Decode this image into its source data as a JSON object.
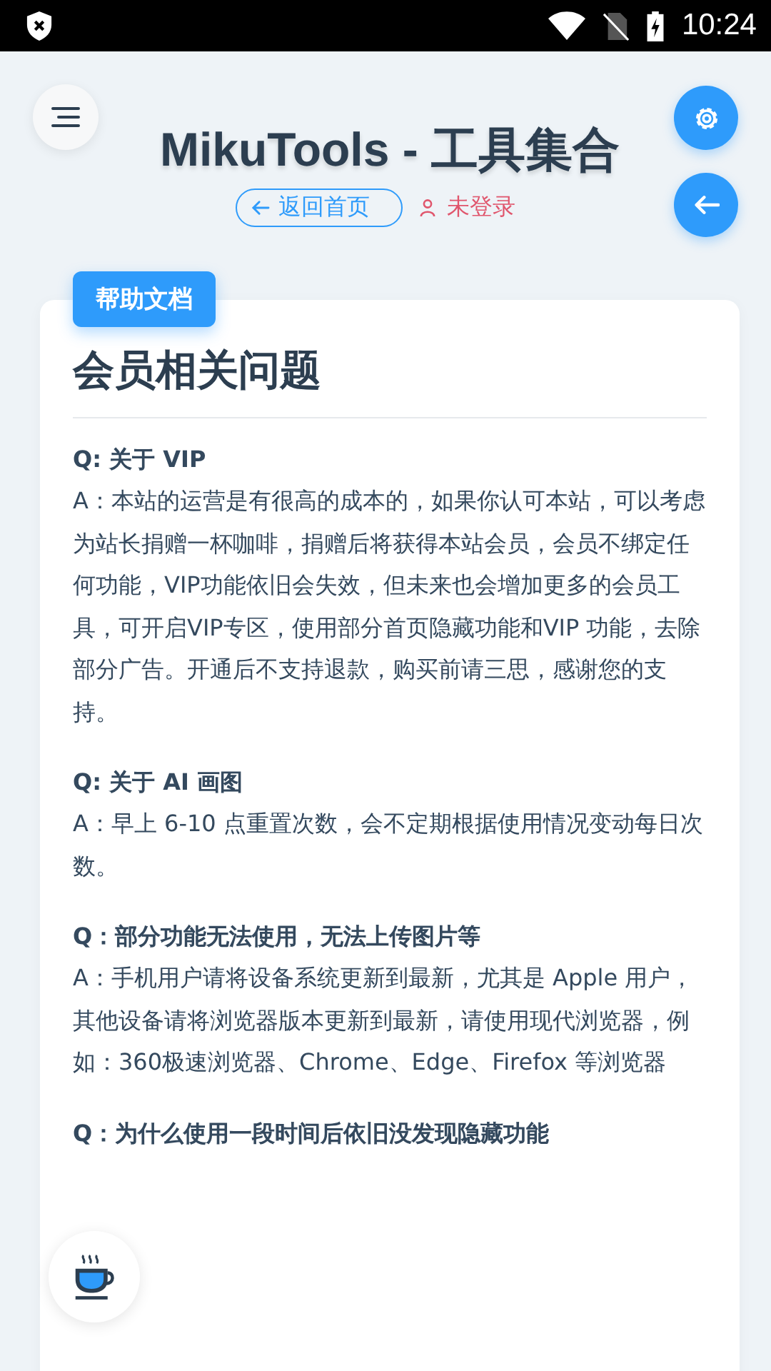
{
  "status_bar": {
    "time": "10:24"
  },
  "header": {
    "title": "MikuTools - 工具集合",
    "back_link": "返回首页",
    "login_status": "未登录"
  },
  "card": {
    "badge": "帮助文档",
    "heading": "会员相关问题",
    "faqs": [
      {
        "question": "Q: 关于 VIP",
        "answer": "A：本站的运营是有很高的成本的，如果你认可本站，可以考虑为站长捐赠一杯咖啡，捐赠后将获得本站会员，会员不绑定任何功能，VIP功能依旧会失效，但未来也会增加更多的会员工具，可开启VIP专区，使用部分首页隐藏功能和VIP 功能，去除部分广告。开通后不支持退款，购买前请三思，感谢您的支持。"
      },
      {
        "question": "Q: 关于 AI 画图",
        "answer": "A：早上 6-10 点重置次数，会不定期根据使用情况变动每日次数。"
      },
      {
        "question": "Q：部分功能无法使用，无法上传图片等",
        "answer": "A：手机用户请将设备系统更新到最新，尤其是 Apple 用户，其他设备请将浏览器版本更新到最新，请使用现代浏览器，例如：360极速浏览器、Chrome、Edge、Firefox 等浏览器"
      },
      {
        "question": "Q：为什么使用一段时间后依旧没发现隐藏功能"
      }
    ]
  }
}
